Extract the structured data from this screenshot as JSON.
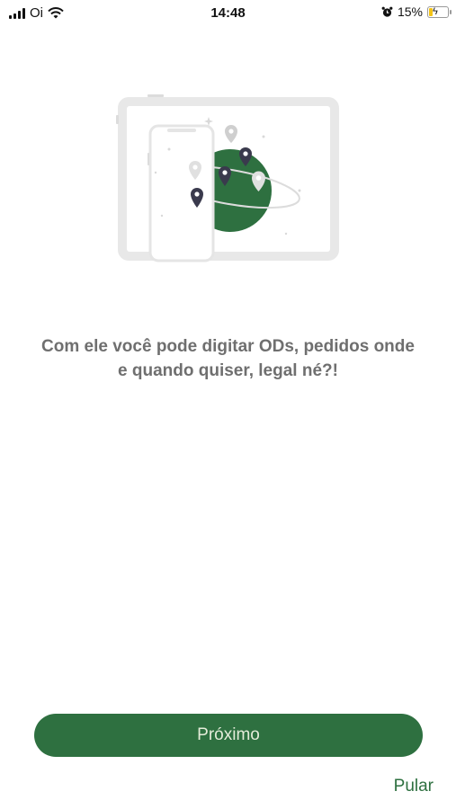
{
  "status_bar": {
    "carrier": "Oi",
    "time": "14:48",
    "battery_percent": "15%",
    "icons": [
      "signal-icon",
      "wifi-icon",
      "alarm-icon",
      "battery-charging-icon"
    ]
  },
  "onboarding": {
    "headline_line1": "Com ele você pode digitar ODs, pedidos onde",
    "headline_line2": "e quando quiser, legal né?!",
    "illustration": "tablet-phone-globe-map-pins",
    "next_label": "Próximo",
    "skip_label": "Pular"
  },
  "colors": {
    "primary_green": "#2e7040",
    "headline_gray": "#6f6f6f",
    "button_text": "#e4ecd9"
  }
}
